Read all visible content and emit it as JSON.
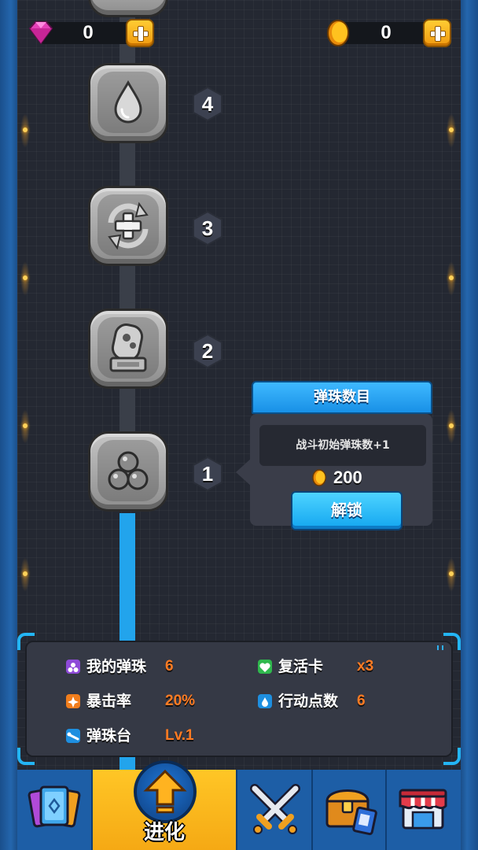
{
  "currency": {
    "gems": "0",
    "coins": "0"
  },
  "path": {
    "nodes": [
      {
        "level": "4",
        "icon": "water-drop-icon"
      },
      {
        "level": "3",
        "icon": "heal-refresh-icon"
      },
      {
        "level": "2",
        "icon": "pinball-machine-icon"
      },
      {
        "level": "1",
        "icon": "marbles-icon"
      }
    ]
  },
  "popup": {
    "title": "弹珠数目",
    "description": "战斗初始弹珠数+1",
    "cost": "200",
    "unlock_label": "解锁"
  },
  "stats": {
    "marbles_label": "我的弹珠",
    "marbles_value": "6",
    "revive_label": "复活卡",
    "revive_value": "x3",
    "crit_label": "暴击率",
    "crit_value": "20%",
    "action_label": "行动点数",
    "action_value": "6",
    "table_label": "弹珠台",
    "table_value": "Lv.1"
  },
  "nav": {
    "evolve_label": "进化"
  },
  "colors": {
    "accent_orange": "#ff7b23",
    "track_blue": "#22a4ec",
    "active_tab": "#ffc626"
  }
}
